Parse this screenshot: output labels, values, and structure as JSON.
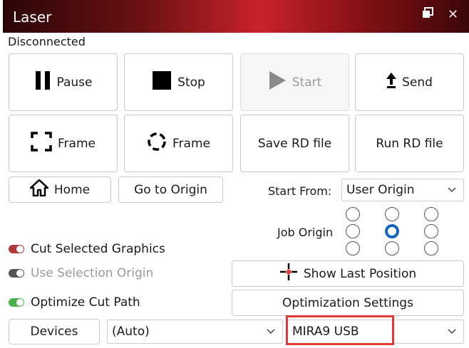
{
  "window": {
    "title": "Laser",
    "restore_icon": "restore-window-icon",
    "close_glyph": "✕"
  },
  "status": "Disconnected",
  "buttons": {
    "pause": "Pause",
    "stop": "Stop",
    "start": "Start",
    "send": "Send",
    "frame": "Frame",
    "frame_circle": "Frame",
    "save_rd": "Save RD file",
    "run_rd": "Run RD file",
    "home": "Home",
    "go_to_origin": "Go to Origin",
    "show_last_position": "Show Last Position",
    "optimization_settings": "Optimization Settings",
    "devices": "Devices"
  },
  "start_from": {
    "label": "Start From:",
    "value": "User Origin"
  },
  "job_origin": {
    "label": "Job Origin",
    "selected": "center"
  },
  "options": [
    {
      "label": "Cut Selected Graphics",
      "enabled": true,
      "state": "off",
      "color": "#b03a3a"
    },
    {
      "label": "Use Selection Origin",
      "enabled": false,
      "state": "off",
      "color": "#555555"
    },
    {
      "label": "Optimize Cut Path",
      "enabled": true,
      "state": "on",
      "color": "#4caf50"
    }
  ],
  "port_select": {
    "value": "(Auto)"
  },
  "device_select": {
    "value": "MIRA9 USB"
  },
  "colors": {
    "accent": "#1565c0",
    "highlight": "#e53935"
  }
}
